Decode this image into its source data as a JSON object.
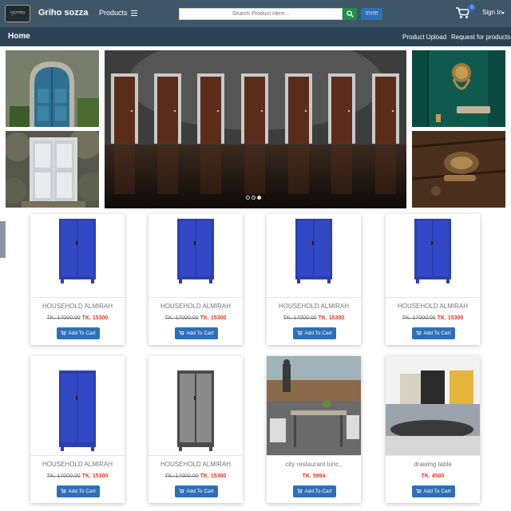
{
  "header": {
    "logo_text": "গৃহসজ্জা",
    "brand": "Griho sozza",
    "products_label": "Products",
    "search_placeholder": "Search Product Here...",
    "language_button": "বাংলা",
    "cart_count": "0",
    "signin_label": "Sign In"
  },
  "nav": {
    "home": "Home",
    "upload": "Product Upload",
    "request": "Request for products"
  },
  "slider": {
    "dots": 3,
    "active_dot": 3
  },
  "colors": {
    "topbar": "#3f5568",
    "navbar": "#2b4255",
    "button_blue": "#2f6fb7",
    "search_green": "#1f8f4a",
    "price_red": "#e0391f"
  },
  "products": [
    {
      "title": "HOUSEHOLD ALMIRAH",
      "old_price": "TK. 17000.00",
      "new_price": "TK. 15300",
      "button": "Add To Cart",
      "icon": "cart-icon"
    },
    {
      "title": "HOUSEHOLD ALMIRAH",
      "old_price": "TK. 17000.00",
      "new_price": "TK. 15300",
      "button": "Add To Cart",
      "icon": "cart-icon"
    },
    {
      "title": "HOUSEHOLD ALMIRAH",
      "old_price": "TK. 17000.00",
      "new_price": "TK. 15300",
      "button": "Add To Cart",
      "icon": "cart-icon"
    },
    {
      "title": "HOUSEHOLD ALMIRAH",
      "old_price": "TK. 17000.00",
      "new_price": "TK. 15300",
      "button": "Add To Cart",
      "icon": "cart-icon"
    },
    {
      "title": "HOUSEHOLD ALMIRAH",
      "old_price": "TK. 17000.00",
      "new_price": "TK. 15300",
      "button": "Add To Cart",
      "icon": "cart-icon"
    },
    {
      "title": "HOUSEHOLD ALMIRAH",
      "old_price": "TK. 17000.00",
      "new_price": "TK. 15300",
      "button": "Add To Cart",
      "icon": "cart-icon"
    },
    {
      "title": "city restaurant lunc..",
      "old_price": "",
      "new_price": "TK. 5994",
      "button": "Add To Cart",
      "icon": "cart-icon"
    },
    {
      "title": "drawing table",
      "old_price": "",
      "new_price": "TK. 4500",
      "button": "Add To Cart",
      "icon": "cart-icon"
    }
  ]
}
